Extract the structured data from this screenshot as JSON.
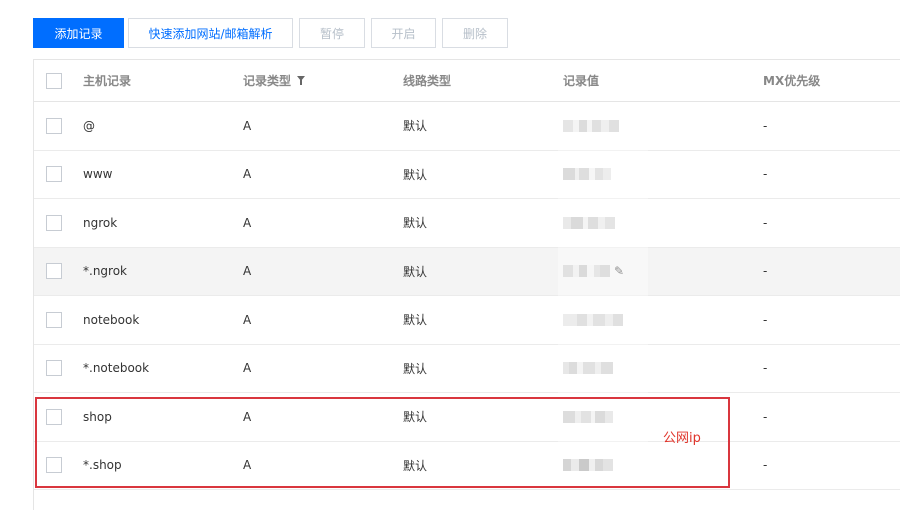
{
  "toolbar": {
    "add_label": "添加记录",
    "quick_add_label": "快速添加网站/邮箱解析",
    "pause_label": "暂停",
    "enable_label": "开启",
    "delete_label": "删除"
  },
  "table": {
    "headers": {
      "host": "主机记录",
      "type": "记录类型",
      "line": "线路类型",
      "value": "记录值",
      "mx": "MX优先级"
    },
    "rows": [
      {
        "host": "@",
        "type": "A",
        "line": "默认",
        "mx": "-"
      },
      {
        "host": "www",
        "type": "A",
        "line": "默认",
        "mx": "-"
      },
      {
        "host": "ngrok",
        "type": "A",
        "line": "默认",
        "mx": "-"
      },
      {
        "host": "*.ngrok",
        "type": "A",
        "line": "默认",
        "mx": "-"
      },
      {
        "host": "notebook",
        "type": "A",
        "line": "默认",
        "mx": "-"
      },
      {
        "host": "*.notebook",
        "type": "A",
        "line": "默认",
        "mx": "-"
      },
      {
        "host": "shop",
        "type": "A",
        "line": "默认",
        "mx": "-"
      },
      {
        "host": "*.shop",
        "type": "A",
        "line": "默认",
        "mx": "-"
      }
    ]
  },
  "annotation": {
    "text": "公网ip",
    "color": "#e0352b"
  },
  "icons": {
    "filter": "filter-icon",
    "edit": "pencil-icon"
  },
  "colors": {
    "primary": "#006eff",
    "highlight": "#d9363e"
  }
}
